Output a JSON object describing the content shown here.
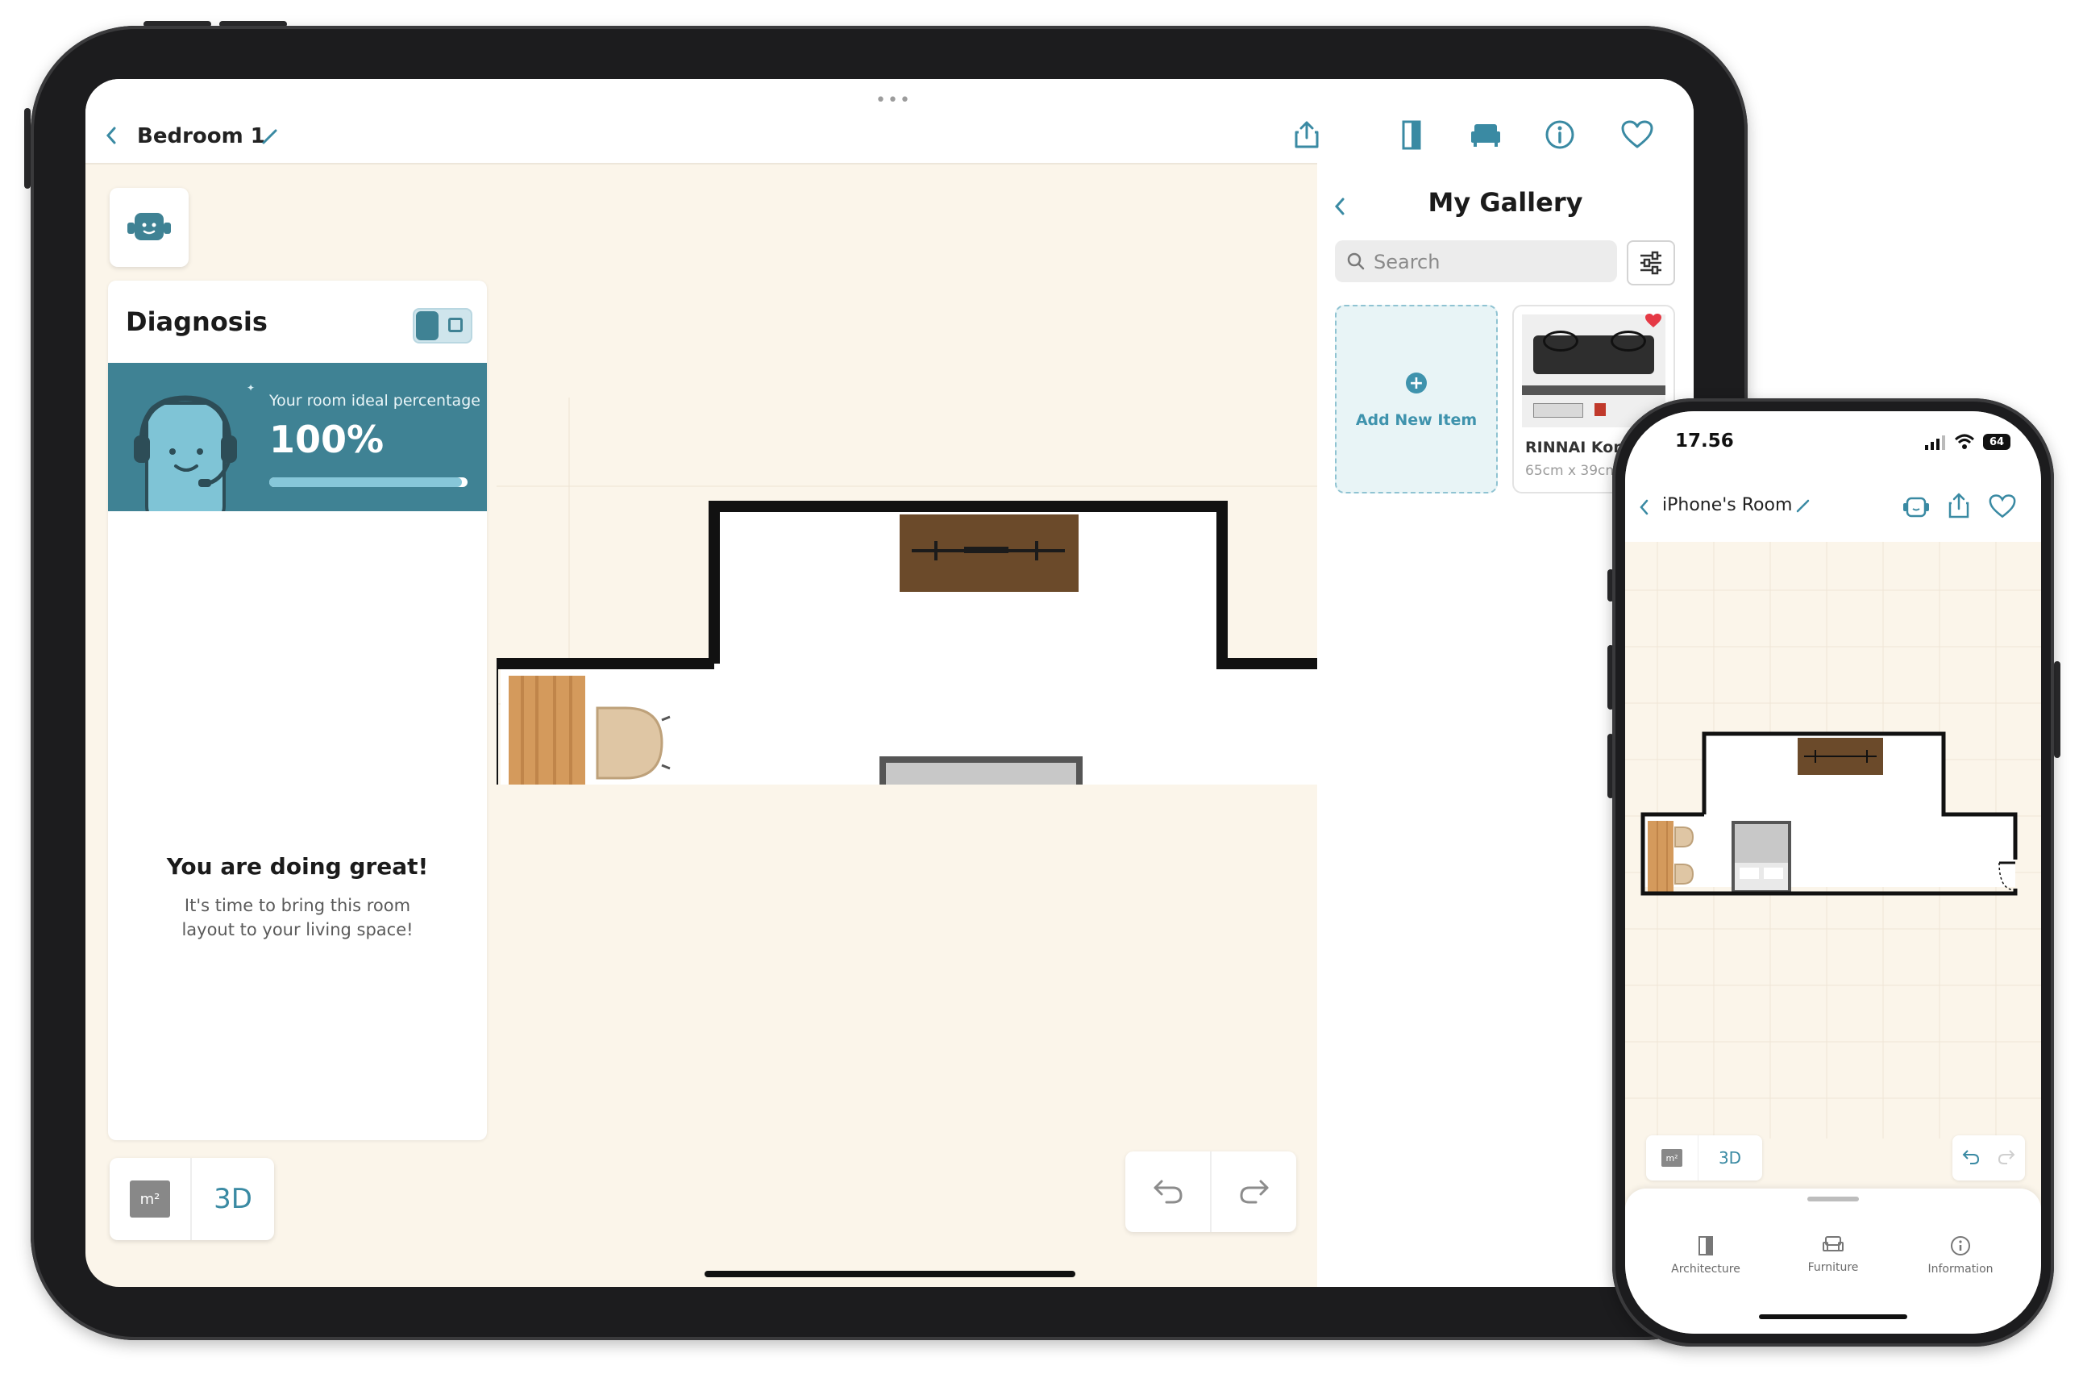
{
  "colors": {
    "accent": "#3a8aa3",
    "canvas": "#fbf5ea",
    "banner": "#3f8294",
    "heart": "#e53945"
  },
  "ipad": {
    "header": {
      "title": "Bedroom 1",
      "icons": [
        "chevron-left-icon",
        "pencil-icon",
        "share-icon",
        "door-icon",
        "armchair-icon",
        "info-icon",
        "heart-icon"
      ]
    },
    "diagnosis": {
      "title": "Diagnosis",
      "percentage_label": "Your room ideal percentage",
      "percentage_value": "100%",
      "progress": 0.97,
      "headline": "You are doing great!",
      "message": "It's time to bring this room layout to your living space!"
    },
    "bottom_toolbar": {
      "area_label": "m²",
      "view_3d": "3D"
    },
    "gallery": {
      "title": "My Gallery",
      "search_placeholder": "Search",
      "add_item_label": "Add New Item",
      "items": [
        {
          "name": "RINNAI Kom",
          "size": "65cm x 39cm",
          "favorited": true
        }
      ]
    }
  },
  "iphone": {
    "status": {
      "time": "17.56",
      "battery": "64"
    },
    "header": {
      "title": "iPhone's Room"
    },
    "bottom_toolbar": {
      "area_label": "m²",
      "view_3d": "3D"
    },
    "tabs": [
      {
        "label": "Architecture",
        "icon": "door-icon"
      },
      {
        "label": "Furniture",
        "icon": "armchair-icon"
      },
      {
        "label": "Information",
        "icon": "info-icon"
      }
    ]
  }
}
